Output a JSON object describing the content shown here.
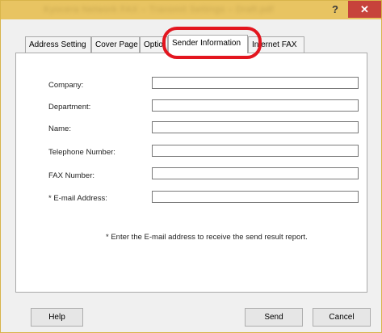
{
  "window": {
    "title": "Kyocera Network FAX – Transmit Settings – Draft.pdf"
  },
  "titlebar": {
    "help_glyph": "?",
    "close_glyph": "✕"
  },
  "tabs": [
    {
      "label": "Address Setting"
    },
    {
      "label": "Cover Page"
    },
    {
      "label": "Optio"
    },
    {
      "label": "Sender Information"
    },
    {
      "label": "Internet FAX"
    }
  ],
  "form": {
    "company_label": "Company:",
    "department_label": "Department:",
    "name_label": "Name:",
    "telephone_label": "Telephone Number:",
    "fax_label": "FAX Number:",
    "email_label": "* E-mail Address:",
    "company_value": "",
    "department_value": "",
    "name_value": "",
    "telephone_value": "",
    "fax_value": "",
    "email_value": ""
  },
  "note": "* Enter the E-mail address to receive the send result report.",
  "buttons": {
    "help": "Help",
    "send": "Send",
    "cancel": "Cancel"
  },
  "colors": {
    "titlebar": "#e8c462",
    "close": "#c7433b",
    "highlight": "#e3161f"
  }
}
